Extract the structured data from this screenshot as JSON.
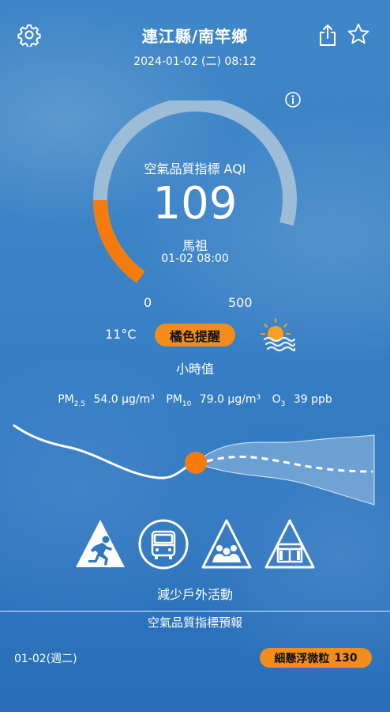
{
  "header": {
    "location": "連江縣/南竿鄉",
    "datetime": "2024-01-02 (二) 08:12",
    "icons": {
      "settings": "gear-icon",
      "share": "share-icon",
      "favorite": "star-icon",
      "info": "info-icon"
    }
  },
  "gauge": {
    "label": "空氣品質指標 AQI",
    "value": 109,
    "value_text": "109",
    "min": "0",
    "max": "500",
    "station": "馬祖",
    "time": "01-02 08:00",
    "colors": {
      "track": "#9dbcd8",
      "fill": "#f57c0c"
    }
  },
  "weather": {
    "temperature": "11°C",
    "alert": "橘色提醒",
    "icon": "sun-haze-icon",
    "value_type": "小時值"
  },
  "pollutants": {
    "pm25_label": "PM",
    "pm25_sub": "2.5",
    "pm25_value": "54.0 μg/m³",
    "pm10_label": "PM",
    "pm10_sub": "10",
    "pm10_value": "79.0 μg/m³",
    "o3_label": "O",
    "o3_sub": "3",
    "o3_value": "39 ppb"
  },
  "activities": {
    "icons": [
      "running-warning-icon",
      "bus-icon",
      "group-warning-icon",
      "window-warning-icon"
    ],
    "advice": "減少戶外活動"
  },
  "forecast": {
    "title": "空氣品質指標預報",
    "date": "01-02(週二)",
    "pollutant": "細懸浮微粒",
    "aqi": "130",
    "accent": "#f28c1a"
  }
}
